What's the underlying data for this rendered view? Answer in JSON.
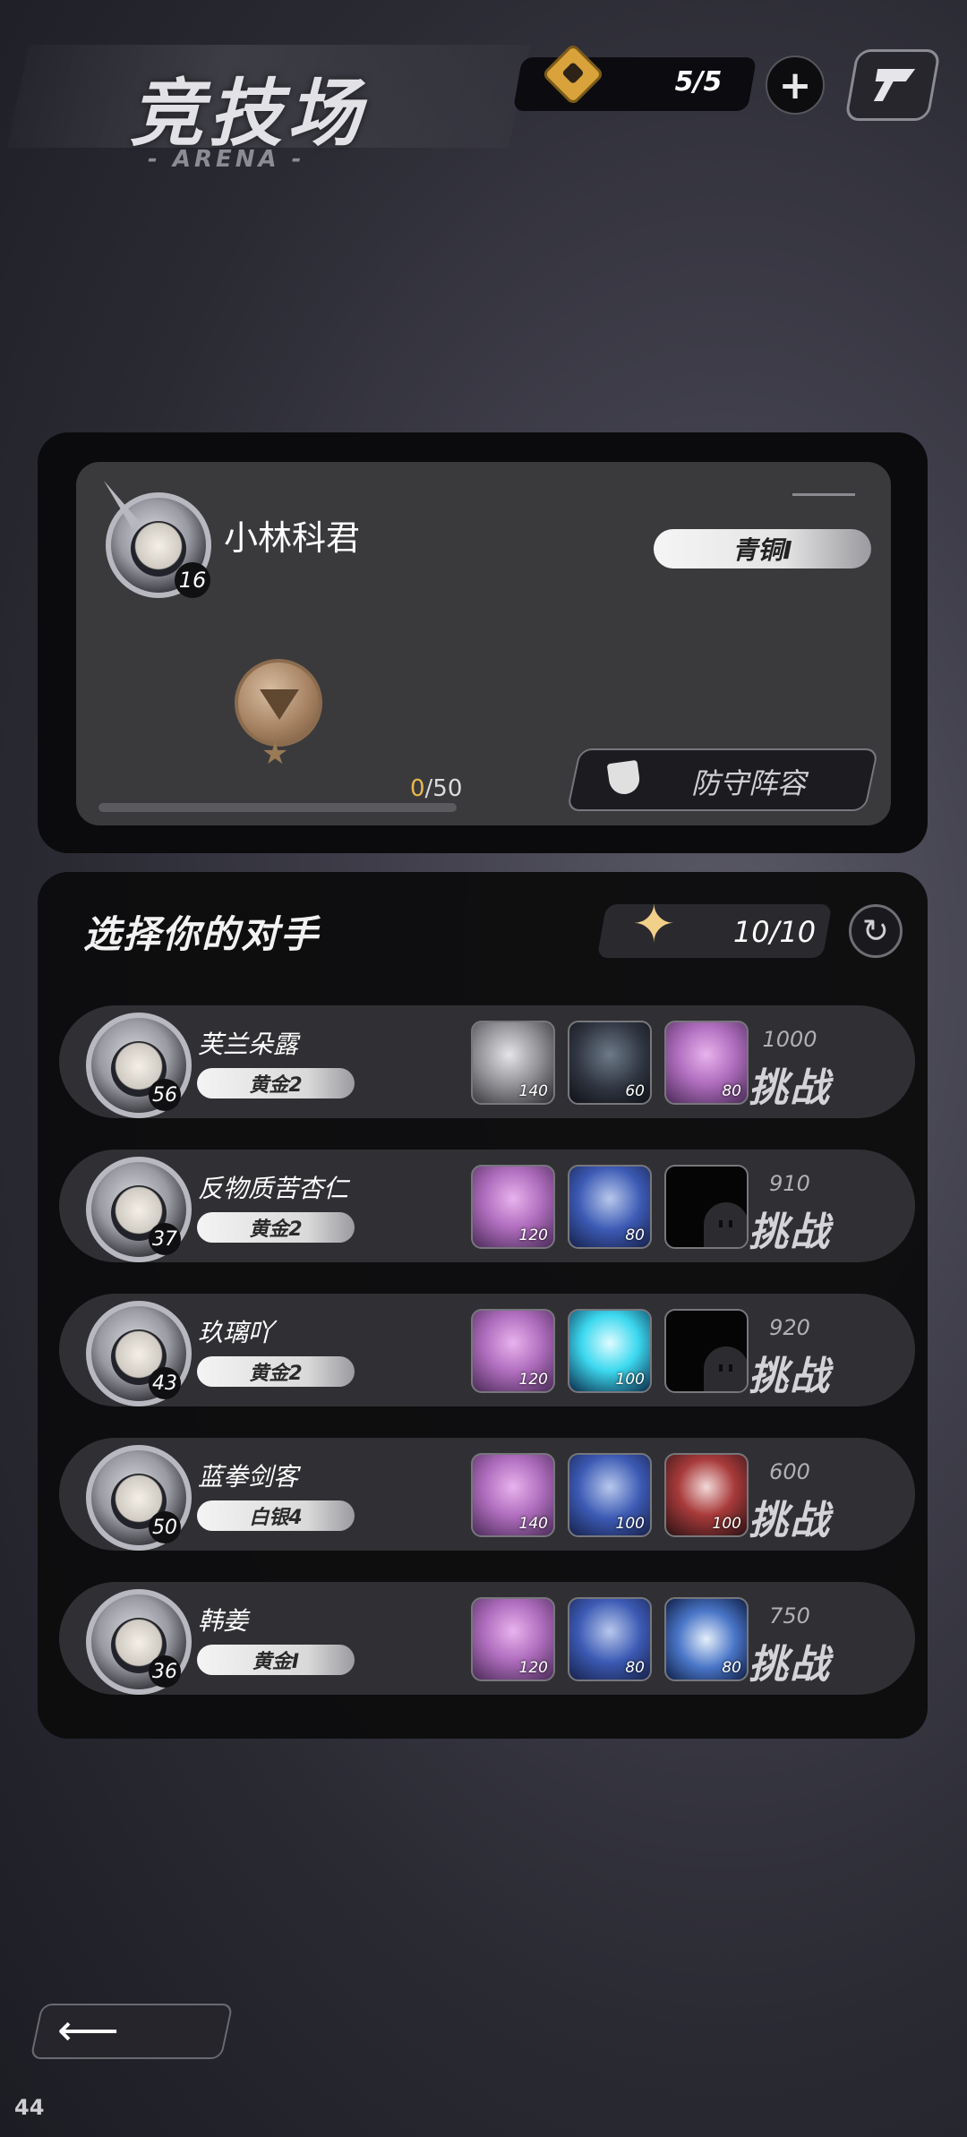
{
  "header": {
    "title": "竞技场",
    "subtitle": "- ARENA -",
    "tickets": "5/5",
    "plus_label": "+",
    "ticket_icon": "arena-ticket-icon",
    "corner_icon": "flag-icon"
  },
  "player": {
    "name": "小林科君",
    "level": "16",
    "rank": "青铜I",
    "progress": {
      "current": "0",
      "max": "/50",
      "fraction": 0.0
    },
    "defense_button": "防守阵容"
  },
  "opponents": {
    "title": "选择你的对手",
    "attempts": "10/10",
    "list": [
      {
        "name": "芙兰朵露",
        "level": "56",
        "rank": "黄金2",
        "power": "1000",
        "challenge": "挑战",
        "heroes": [
          {
            "style": "grey",
            "level": "140"
          },
          {
            "style": "dark",
            "level": "60"
          },
          {
            "style": "pink",
            "level": "80"
          }
        ]
      },
      {
        "name": "反物质苦杏仁",
        "level": "37",
        "rank": "黄金2",
        "power": "910",
        "challenge": "挑战",
        "heroes": [
          {
            "style": "pink",
            "level": "120"
          },
          {
            "style": "blue",
            "level": "80"
          },
          {
            "style": "empty",
            "level": ""
          }
        ]
      },
      {
        "name": "玖璃吖",
        "level": "43",
        "rank": "黄金2",
        "power": "920",
        "challenge": "挑战",
        "heroes": [
          {
            "style": "pink",
            "level": "120"
          },
          {
            "style": "cyan",
            "level": "100"
          },
          {
            "style": "empty",
            "level": ""
          }
        ]
      },
      {
        "name": "蓝拳剑客",
        "level": "50",
        "rank": "白银4",
        "power": "600",
        "challenge": "挑战",
        "heroes": [
          {
            "style": "pink",
            "level": "140"
          },
          {
            "style": "blue",
            "level": "100"
          },
          {
            "style": "red",
            "level": "100"
          }
        ]
      },
      {
        "name": "韩姜",
        "level": "36",
        "rank": "黄金I",
        "power": "750",
        "challenge": "挑战",
        "heroes": [
          {
            "style": "pink",
            "level": "120"
          },
          {
            "style": "blue",
            "level": "80"
          },
          {
            "style": "mech",
            "level": "80"
          }
        ]
      }
    ]
  },
  "footer": {
    "back_icon": "back-arrow-icon",
    "fps": "44"
  },
  "colors": {
    "accent_gold": "#e8b84a",
    "panel": "#0b0b0d"
  }
}
